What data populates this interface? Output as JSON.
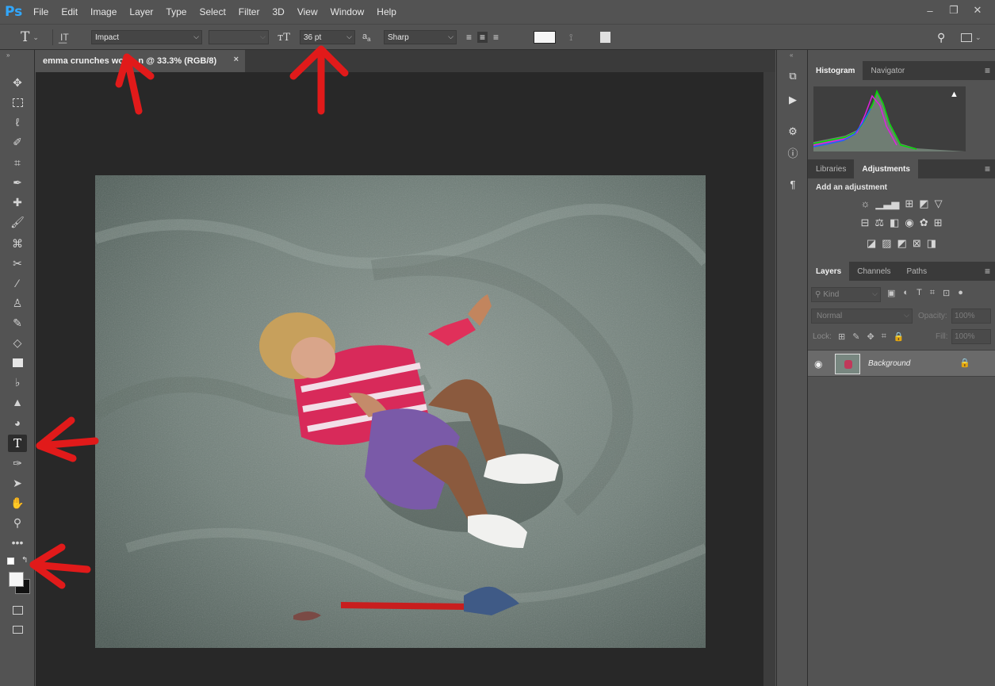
{
  "app": {
    "logo": "Ps"
  },
  "menu": [
    "File",
    "Edit",
    "Image",
    "Layer",
    "Type",
    "Select",
    "Filter",
    "3D",
    "View",
    "Window",
    "Help"
  ],
  "options": {
    "font_family": "Impact",
    "font_size": "36 pt",
    "antialias_label": "a",
    "antialias": "Sharp"
  },
  "document": {
    "tab_title": "emma crunches wo      n @ 33.3% (RGB/8)",
    "close": "×"
  },
  "panels": {
    "top_tabs": [
      "Histogram",
      "Navigator"
    ],
    "mid_tabs": [
      "Libraries",
      "Adjustments"
    ],
    "adjust_heading": "Add an adjustment",
    "layer_tabs": [
      "Layers",
      "Channels",
      "Paths"
    ],
    "kind_placeholder": "Kind",
    "blend_mode": "Normal",
    "opacity_label": "Opacity:",
    "opacity_value": "100%",
    "lock_label": "Lock:",
    "fill_label": "Fill:",
    "fill_value": "100%",
    "layer_name": "Background"
  },
  "colors": {
    "annotation_red": "#e11a1a",
    "accent": "#31a8ff"
  }
}
